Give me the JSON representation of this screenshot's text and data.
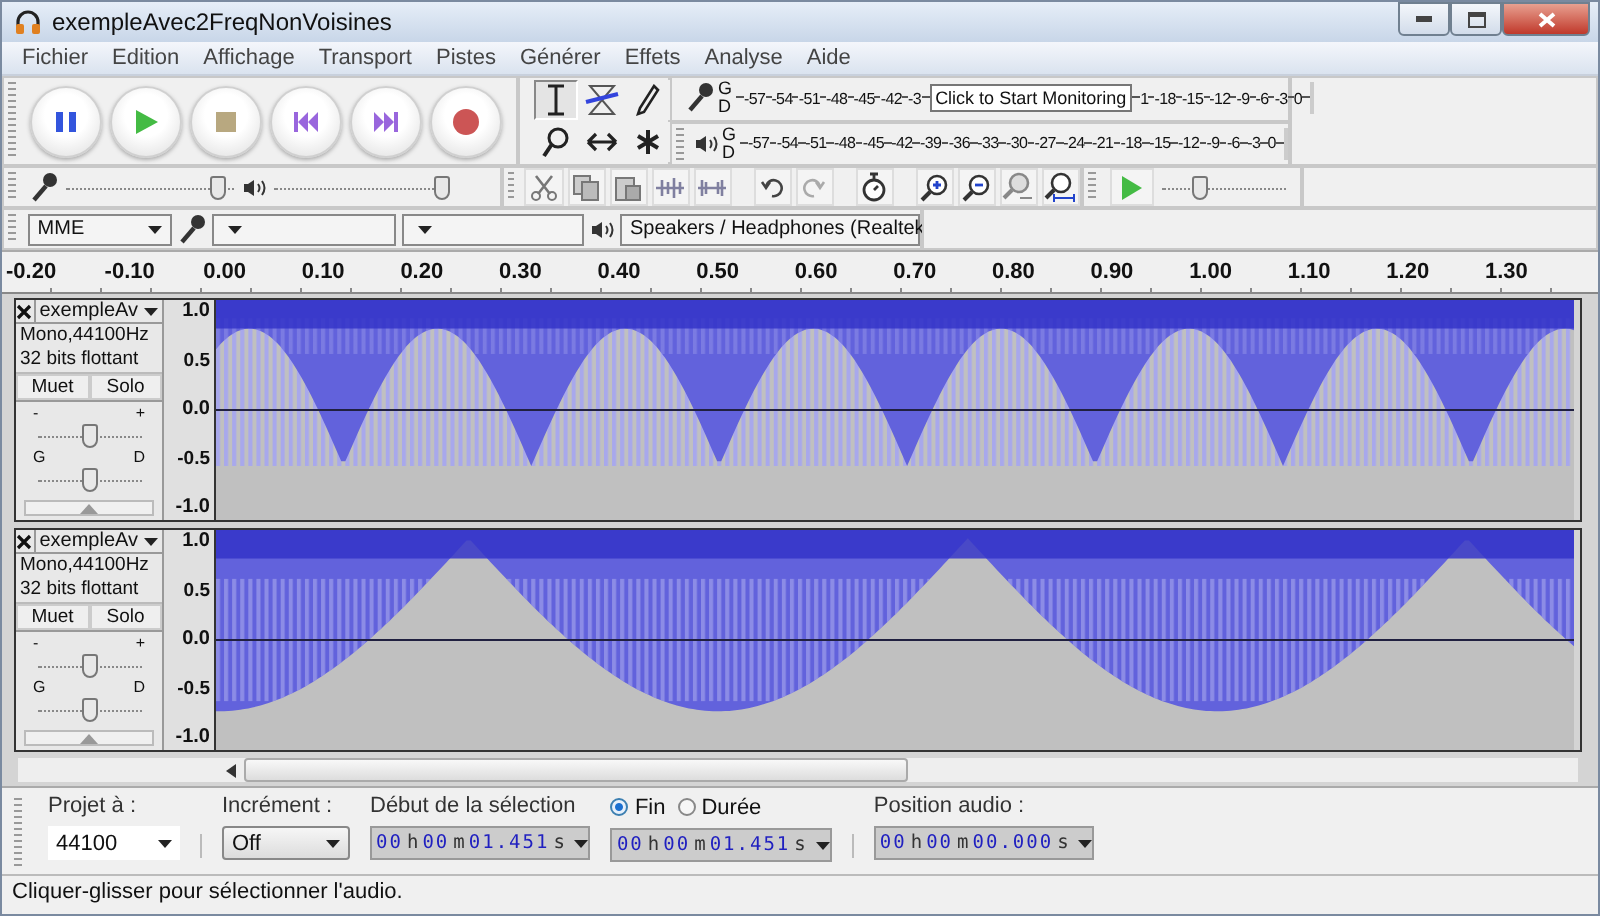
{
  "window": {
    "title": "exempleAvec2FreqNonVoisines"
  },
  "menu": [
    "Fichier",
    "Edition",
    "Affichage",
    "Transport",
    "Pistes",
    "Générer",
    "Effets",
    "Analyse",
    "Aide"
  ],
  "transport": [
    {
      "kind": "pause"
    },
    {
      "kind": "play"
    },
    {
      "kind": "stop"
    },
    {
      "kind": "start"
    },
    {
      "kind": "end"
    },
    {
      "kind": "record"
    }
  ],
  "tools": [
    {
      "kind": "select",
      "selected": true
    },
    {
      "kind": "envelope",
      "selected": false
    },
    {
      "kind": "draw",
      "selected": false
    },
    {
      "kind": "zoom",
      "selected": false
    },
    {
      "kind": "timeshift",
      "selected": false
    },
    {
      "kind": "multi",
      "selected": false
    }
  ],
  "meters": [
    {
      "kind": "record",
      "channels": [
        "G",
        "D"
      ],
      "ticks": [
        "-57",
        "-54",
        "-51",
        "-48",
        "-45",
        "-42",
        "-3"
      ],
      "tooltip": "Click to Start Monitoring",
      "ticks_after": [
        "1",
        "-18",
        "-15",
        "-12",
        "-9",
        "-6",
        "-3",
        "0"
      ]
    },
    {
      "kind": "playback",
      "channels": [
        "G",
        "D"
      ],
      "ticks": [
        "-57",
        "-54",
        "-51",
        "-48",
        "-45",
        "-42",
        "-39",
        "-36",
        "-33",
        "-30",
        "-27",
        "-24",
        "-21",
        "-18",
        "-15",
        "-12",
        "-9",
        "-6",
        "-3",
        "0"
      ]
    }
  ],
  "mixer": {
    "input": {
      "level": 0.9
    },
    "output": {
      "level": 1.0
    }
  },
  "play_at_speed": {
    "level": 0.3
  },
  "devices": {
    "host": "MME",
    "output": "Speakers / Headphones (Realtek"
  },
  "ruler": [
    "-0.20",
    "-0.10",
    "0.00",
    "0.10",
    "0.20",
    "0.30",
    "0.40",
    "0.50",
    "0.60",
    "0.70",
    "0.80",
    "0.90",
    "1.00",
    "1.10",
    "1.20",
    "1.30"
  ],
  "tracks": [
    {
      "name": "exempleAv",
      "info": [
        "Mono,44100Hz",
        "32 bits flottant"
      ],
      "mute": "Muet",
      "solo": "Solo",
      "gain_labels": [
        "-",
        "+"
      ],
      "gain": {
        "level": 0.5
      },
      "pan_labels": [
        "G",
        "D"
      ],
      "pan": {
        "level": 0.5
      },
      "scale": [
        "1.0",
        "0.5",
        "0.0",
        "-0.5",
        "-1.0"
      ]
    },
    {
      "name": "exempleAv",
      "info": [
        "Mono,44100Hz",
        "32 bits flottant"
      ],
      "mute": "Muet",
      "solo": "Solo",
      "gain_labels": [
        "-",
        "+"
      ],
      "gain": {
        "level": 0.5
      },
      "pan_labels": [
        "G",
        "D"
      ],
      "pan": {
        "level": 0.5
      },
      "scale": [
        "1.0",
        "0.5",
        "0.0",
        "-0.5",
        "-1.0"
      ]
    }
  ],
  "selection_bar": {
    "rate_label": "Projet à :",
    "rate": "44100",
    "snap_label": "Incrément :",
    "snap": "Off",
    "start_label": "Début de la sélection",
    "start": "00 h 00 m 01.451 s",
    "end_options": [
      {
        "label": "Fin",
        "selected": true
      },
      {
        "label": "Durée",
        "selected": false
      }
    ],
    "end": "00 h 00 m 01.451 s",
    "position_label": "Position audio :",
    "position": "00 h 00 m 00.000 s"
  },
  "status_bar": {
    "text": "Cliquer-glisser pour sélectionner l'audio."
  }
}
